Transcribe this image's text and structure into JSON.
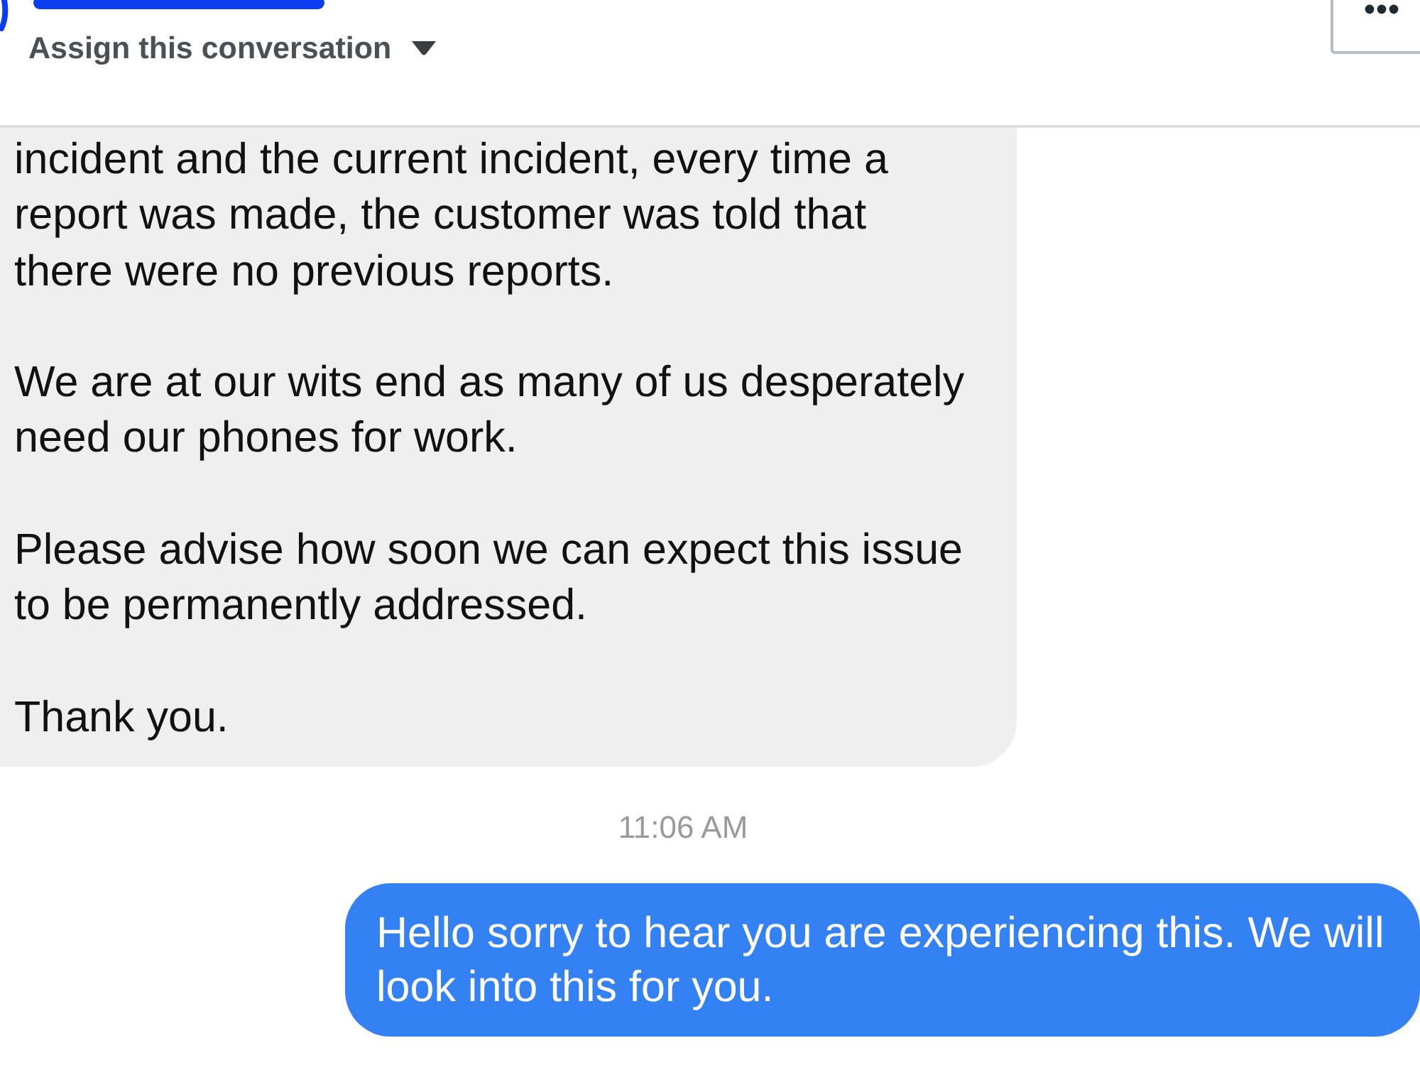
{
  "header": {
    "assign_label": "Assign this conversation"
  },
  "messages": [
    {
      "kind": "received",
      "paragraphs": [
        "incident and the current incident, every time a report was made, the customer was told that there were no previous reports.",
        "We are at our wits end as many of us desperately need our phones for work.",
        "Please advise how soon we can expect this issue to be permanently addressed.",
        "Thank you."
      ]
    },
    {
      "kind": "timestamp",
      "text": "11:06 AM"
    },
    {
      "kind": "sent",
      "paragraphs": [
        "Hello sorry to hear you are experiencing this. We will look into this for you."
      ]
    }
  ]
}
